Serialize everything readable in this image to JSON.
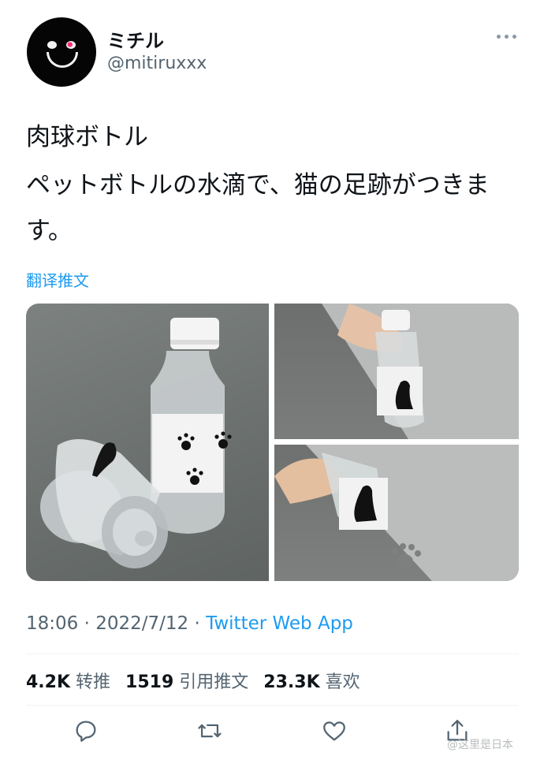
{
  "user": {
    "display_name": "ミチル",
    "handle": "@mitiruxxx"
  },
  "tweet": {
    "title": "肉球ボトル",
    "body": "ペットボトルの水滴で、猫の足跡がつきます。",
    "translate_label": "翻译推文"
  },
  "meta": {
    "time": "18:06",
    "separator": " · ",
    "date": "2022/7/12",
    "source": "Twitter Web App"
  },
  "stats": {
    "retweets": "4.2K",
    "retweets_label": "转推",
    "quotes": "1519",
    "quotes_label": "引用推文",
    "likes": "23.3K",
    "likes_label": "喜欢"
  },
  "actions": {
    "icons": [
      "reply-icon",
      "retweet-icon",
      "like-icon",
      "share-icon"
    ]
  },
  "watermark": "@这里是日本",
  "colors": {
    "accent": "#1d9bf0",
    "text": "#0f1419",
    "secondary": "#536471",
    "avatar": "#050505"
  }
}
